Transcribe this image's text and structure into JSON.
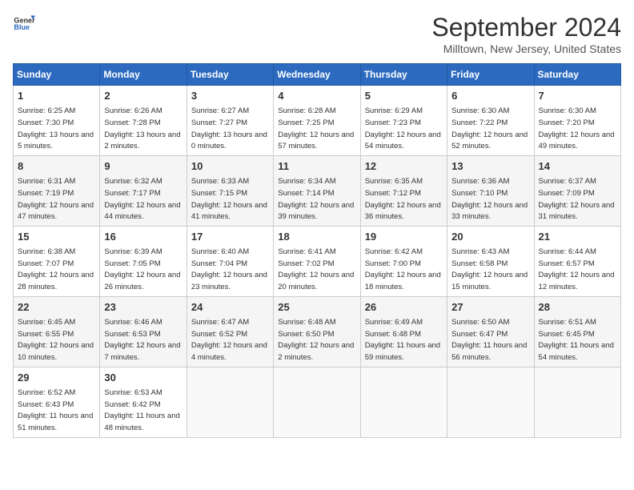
{
  "header": {
    "logo_line1": "General",
    "logo_line2": "Blue",
    "month": "September 2024",
    "location": "Milltown, New Jersey, United States"
  },
  "weekdays": [
    "Sunday",
    "Monday",
    "Tuesday",
    "Wednesday",
    "Thursday",
    "Friday",
    "Saturday"
  ],
  "weeks": [
    [
      {
        "day": 1,
        "sunrise": "6:25 AM",
        "sunset": "7:30 PM",
        "daylight": "13 hours and 5 minutes."
      },
      {
        "day": 2,
        "sunrise": "6:26 AM",
        "sunset": "7:28 PM",
        "daylight": "13 hours and 2 minutes."
      },
      {
        "day": 3,
        "sunrise": "6:27 AM",
        "sunset": "7:27 PM",
        "daylight": "13 hours and 0 minutes."
      },
      {
        "day": 4,
        "sunrise": "6:28 AM",
        "sunset": "7:25 PM",
        "daylight": "12 hours and 57 minutes."
      },
      {
        "day": 5,
        "sunrise": "6:29 AM",
        "sunset": "7:23 PM",
        "daylight": "12 hours and 54 minutes."
      },
      {
        "day": 6,
        "sunrise": "6:30 AM",
        "sunset": "7:22 PM",
        "daylight": "12 hours and 52 minutes."
      },
      {
        "day": 7,
        "sunrise": "6:30 AM",
        "sunset": "7:20 PM",
        "daylight": "12 hours and 49 minutes."
      }
    ],
    [
      {
        "day": 8,
        "sunrise": "6:31 AM",
        "sunset": "7:19 PM",
        "daylight": "12 hours and 47 minutes."
      },
      {
        "day": 9,
        "sunrise": "6:32 AM",
        "sunset": "7:17 PM",
        "daylight": "12 hours and 44 minutes."
      },
      {
        "day": 10,
        "sunrise": "6:33 AM",
        "sunset": "7:15 PM",
        "daylight": "12 hours and 41 minutes."
      },
      {
        "day": 11,
        "sunrise": "6:34 AM",
        "sunset": "7:14 PM",
        "daylight": "12 hours and 39 minutes."
      },
      {
        "day": 12,
        "sunrise": "6:35 AM",
        "sunset": "7:12 PM",
        "daylight": "12 hours and 36 minutes."
      },
      {
        "day": 13,
        "sunrise": "6:36 AM",
        "sunset": "7:10 PM",
        "daylight": "12 hours and 33 minutes."
      },
      {
        "day": 14,
        "sunrise": "6:37 AM",
        "sunset": "7:09 PM",
        "daylight": "12 hours and 31 minutes."
      }
    ],
    [
      {
        "day": 15,
        "sunrise": "6:38 AM",
        "sunset": "7:07 PM",
        "daylight": "12 hours and 28 minutes."
      },
      {
        "day": 16,
        "sunrise": "6:39 AM",
        "sunset": "7:05 PM",
        "daylight": "12 hours and 26 minutes."
      },
      {
        "day": 17,
        "sunrise": "6:40 AM",
        "sunset": "7:04 PM",
        "daylight": "12 hours and 23 minutes."
      },
      {
        "day": 18,
        "sunrise": "6:41 AM",
        "sunset": "7:02 PM",
        "daylight": "12 hours and 20 minutes."
      },
      {
        "day": 19,
        "sunrise": "6:42 AM",
        "sunset": "7:00 PM",
        "daylight": "12 hours and 18 minutes."
      },
      {
        "day": 20,
        "sunrise": "6:43 AM",
        "sunset": "6:58 PM",
        "daylight": "12 hours and 15 minutes."
      },
      {
        "day": 21,
        "sunrise": "6:44 AM",
        "sunset": "6:57 PM",
        "daylight": "12 hours and 12 minutes."
      }
    ],
    [
      {
        "day": 22,
        "sunrise": "6:45 AM",
        "sunset": "6:55 PM",
        "daylight": "12 hours and 10 minutes."
      },
      {
        "day": 23,
        "sunrise": "6:46 AM",
        "sunset": "6:53 PM",
        "daylight": "12 hours and 7 minutes."
      },
      {
        "day": 24,
        "sunrise": "6:47 AM",
        "sunset": "6:52 PM",
        "daylight": "12 hours and 4 minutes."
      },
      {
        "day": 25,
        "sunrise": "6:48 AM",
        "sunset": "6:50 PM",
        "daylight": "12 hours and 2 minutes."
      },
      {
        "day": 26,
        "sunrise": "6:49 AM",
        "sunset": "6:48 PM",
        "daylight": "11 hours and 59 minutes."
      },
      {
        "day": 27,
        "sunrise": "6:50 AM",
        "sunset": "6:47 PM",
        "daylight": "11 hours and 56 minutes."
      },
      {
        "day": 28,
        "sunrise": "6:51 AM",
        "sunset": "6:45 PM",
        "daylight": "11 hours and 54 minutes."
      }
    ],
    [
      {
        "day": 29,
        "sunrise": "6:52 AM",
        "sunset": "6:43 PM",
        "daylight": "11 hours and 51 minutes."
      },
      {
        "day": 30,
        "sunrise": "6:53 AM",
        "sunset": "6:42 PM",
        "daylight": "11 hours and 48 minutes."
      },
      null,
      null,
      null,
      null,
      null
    ]
  ]
}
